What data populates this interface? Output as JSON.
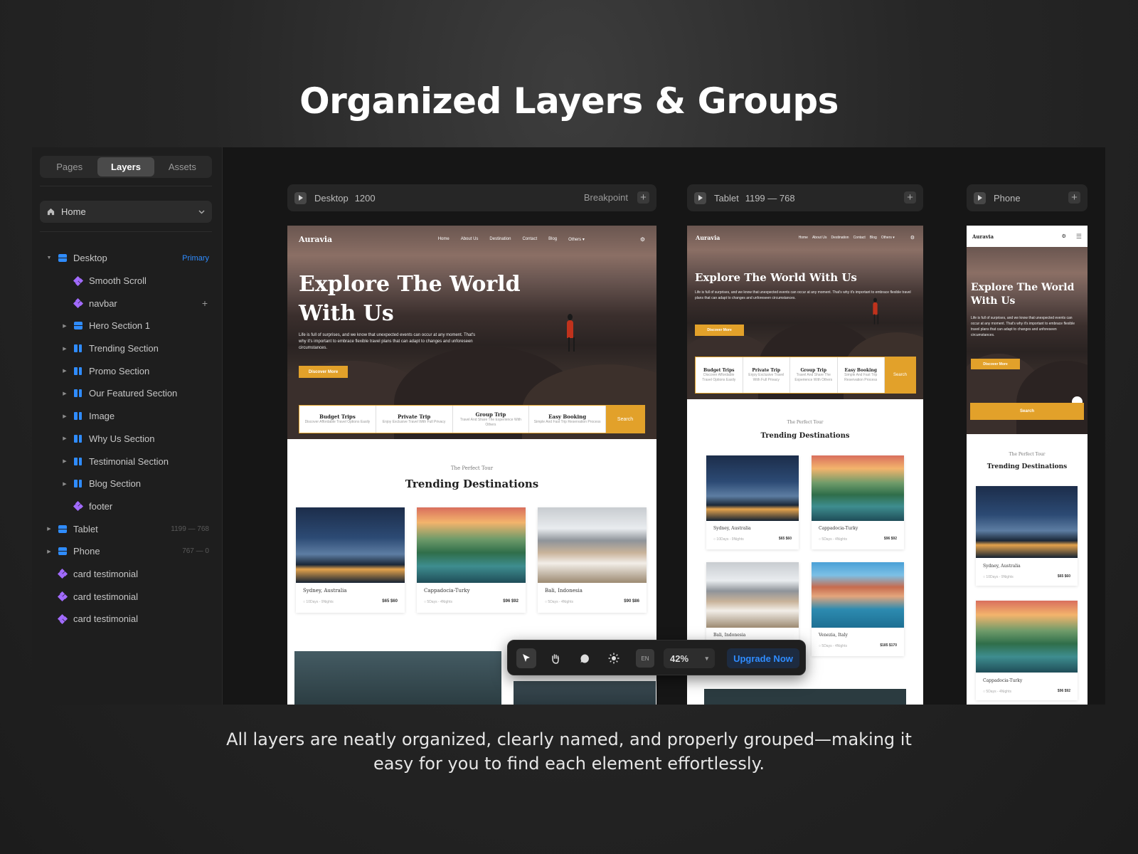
{
  "headline": "Organized Layers & Groups",
  "caption_line1": "All layers are neatly organized, clearly named, and properly grouped—making it",
  "caption_line2": "easy for you to find each element effortlessly.",
  "sidebar": {
    "tabs": [
      "Pages",
      "Layers",
      "Assets"
    ],
    "active_tab": "Layers",
    "page_selector": "Home",
    "layers": [
      {
        "label": "Desktop",
        "icon": "frame-icon",
        "depth": 0,
        "caret": "down",
        "meta": "Primary"
      },
      {
        "label": "Smooth Scroll",
        "icon": "component-icon",
        "depth": 1
      },
      {
        "label": "navbar",
        "icon": "component-icon",
        "depth": 1,
        "action": "+"
      },
      {
        "label": "Hero Section 1",
        "icon": "frame-icon",
        "depth": 1,
        "caret": "right"
      },
      {
        "label": "Trending Section",
        "icon": "stack-icon",
        "depth": 1,
        "caret": "right"
      },
      {
        "label": "Promo Section",
        "icon": "stack-icon",
        "depth": 1,
        "caret": "right"
      },
      {
        "label": "Our Featured Section",
        "icon": "stack-icon",
        "depth": 1,
        "caret": "right"
      },
      {
        "label": "Image",
        "icon": "stack-icon",
        "depth": 1,
        "caret": "right"
      },
      {
        "label": "Why Us Section",
        "icon": "stack-icon",
        "depth": 1,
        "caret": "right"
      },
      {
        "label": "Testimonial Section",
        "icon": "stack-icon",
        "depth": 1,
        "caret": "right"
      },
      {
        "label": "Blog Section",
        "icon": "stack-icon",
        "depth": 1,
        "caret": "right"
      },
      {
        "label": "footer",
        "icon": "component-icon",
        "depth": 1
      },
      {
        "label": "Tablet",
        "icon": "frame-icon",
        "depth": 0,
        "caret": "right",
        "meta": "1199 — 768"
      },
      {
        "label": "Phone",
        "icon": "frame-icon",
        "depth": 0,
        "caret": "right",
        "meta": "767 — 0"
      },
      {
        "label": "card testimonial",
        "icon": "component-icon",
        "depth": 0
      },
      {
        "label": "card testimonial",
        "icon": "component-icon",
        "depth": 0
      },
      {
        "label": "card testimonial",
        "icon": "component-icon",
        "depth": 0
      }
    ]
  },
  "breakpoints": {
    "desktop": {
      "name": "Desktop",
      "size": "1200",
      "action": "Breakpoint"
    },
    "tablet": {
      "name": "Tablet",
      "size": "1199 — 768"
    },
    "phone": {
      "name": "Phone"
    }
  },
  "site": {
    "logo": "Auravia",
    "nav": [
      "Home",
      "About Us",
      "Destination",
      "Contact",
      "Blog",
      "Others ▾"
    ],
    "hero_title_line1": "Explore The World",
    "hero_title_line2": "With Us",
    "hero_title_tablet": "Explore The World With Us",
    "hero_text": "Life is full of surprises, and we know that unexpected events can occur at any moment. That's why it's important to embrace flexible travel plans that can adapt to changes and unforeseen circumstances.",
    "cta": "Discover More",
    "search": [
      {
        "title": "Budget Trips",
        "desc": "Discover Affordable Travel Options Easily"
      },
      {
        "title": "Private Trip",
        "desc": "Enjoy Exclusive Travel With Full Privacy"
      },
      {
        "title": "Group Trip",
        "desc": "Travel And Share The Experience With Others"
      },
      {
        "title": "Easy Booking",
        "desc": "Simple And Fast Trip Reservation Process"
      }
    ],
    "search_btn": "Search",
    "kicker": "The Perfect Tour",
    "section_title": "Trending Destinations",
    "cards": [
      {
        "name": "Sydney, Australia",
        "meta": "○ 10Days - 9Nights",
        "price": "$65 $60"
      },
      {
        "name": "Cappadocia-Turky",
        "meta": "○ 5Days - 4Nights",
        "price": "$96 $92"
      },
      {
        "name": "Bali, Indonesia",
        "meta": "○ 5Days - 4Nights",
        "price": "$90 $86"
      },
      {
        "name": "Venezia, Italy",
        "meta": "○ 5Days - 4Nights",
        "price": "$185 $170"
      }
    ]
  },
  "toolbar": {
    "lang": "EN",
    "zoom": "42%",
    "upgrade": "Upgrade Now",
    "tools": [
      "cursor-icon",
      "hand-icon",
      "comment-icon",
      "sun-icon"
    ]
  },
  "colors": {
    "accent": "#2f8cff",
    "component": "#a26bff",
    "brand": "#e2a12a"
  }
}
